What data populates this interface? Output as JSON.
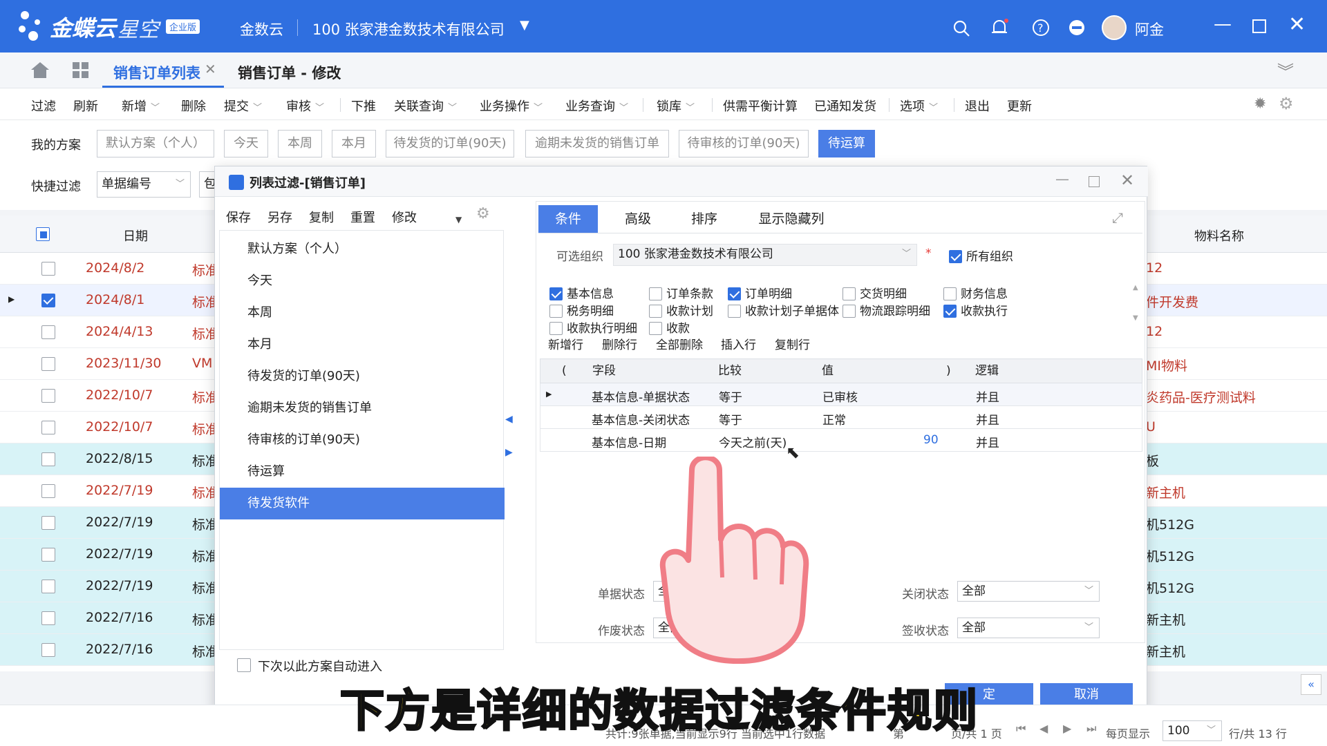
{
  "topbar": {
    "brand": "金蝶云",
    "brand2": "星空",
    "edition": "企业版",
    "tenant": "金数云",
    "org": "100  张家港金数技术有限公司",
    "user": "阿金"
  },
  "tabs": {
    "list_tab": "销售订单列表",
    "edit_tab": "销售订单 - 修改"
  },
  "toolbar": [
    "过滤",
    "刷新",
    "新增",
    "删除",
    "提交",
    "审核",
    "下推",
    "关联查询",
    "业务操作",
    "业务查询",
    "锁库",
    "供需平衡计算",
    "已通知发货",
    "选项",
    "退出",
    "更新"
  ],
  "scheme": {
    "label": "我的方案",
    "items": [
      "默认方案（个人）",
      "今天",
      "本周",
      "本月",
      "待发货的订单(90天)",
      "逾期未发货的销售订单",
      "待审核的订单(90天)",
      "待运算"
    ],
    "quick_label": "快捷过滤",
    "quick_field": "单据编号",
    "quick_extra": "包"
  },
  "list": {
    "col_date": "日期",
    "col_material": "物料名称",
    "rows": [
      {
        "date": "2024/8/2",
        "type": "标准",
        "mat": "12",
        "red": true
      },
      {
        "date": "2024/8/1",
        "type": "标准",
        "mat": "件开发费",
        "red": true,
        "checked": true
      },
      {
        "date": "2024/4/13",
        "type": "标准",
        "mat": "12",
        "red": true
      },
      {
        "date": "2023/11/30",
        "type": "VM",
        "mat": "MI物料",
        "red": true
      },
      {
        "date": "2022/10/7",
        "type": "标准",
        "mat": "炎药品-医疗测试料",
        "red": true
      },
      {
        "date": "2022/10/7",
        "type": "标准",
        "mat": "U",
        "red": true
      },
      {
        "date": "2022/8/15",
        "type": "标准",
        "mat": "板",
        "red": false
      },
      {
        "date": "2022/7/19",
        "type": "标准",
        "mat": "新主机",
        "red": true
      },
      {
        "date": "2022/7/19",
        "type": "标准",
        "mat": "机512G",
        "red": false
      },
      {
        "date": "2022/7/19",
        "type": "标准",
        "mat": "机512G",
        "red": false
      },
      {
        "date": "2022/7/19",
        "type": "标准",
        "mat": "机512G",
        "red": false
      },
      {
        "date": "2022/7/16",
        "type": "标准",
        "mat": "新主机",
        "red": false
      },
      {
        "date": "2022/7/16",
        "type": "标准",
        "mat": "新主机",
        "red": false
      }
    ]
  },
  "dialog": {
    "title": "列表过滤-[销售订单]",
    "actions": [
      "保存",
      "另存",
      "复制",
      "重置",
      "修改"
    ],
    "schemes": [
      "默认方案（个人）",
      "今天",
      "本周",
      "本月",
      "待发货的订单(90天)",
      "逾期未发货的销售订单",
      "待审核的订单(90天)",
      "待运算",
      "待发货软件"
    ],
    "auto_enter": "下次以此方案自动进入",
    "ctabs": [
      "条件",
      "高级",
      "排序",
      "显示隐藏列"
    ],
    "org_label": "可选组织",
    "org_value": "100 张家港金数技术有限公司",
    "all_org": "所有组织",
    "required": "*",
    "checks": [
      {
        "label": "基本信息",
        "on": true
      },
      {
        "label": "订单条款",
        "on": false
      },
      {
        "label": "订单明细",
        "on": true
      },
      {
        "label": "交货明细",
        "on": false
      },
      {
        "label": "财务信息",
        "on": false
      },
      {
        "label": "税务明细",
        "on": false
      },
      {
        "label": "收款计划",
        "on": false
      },
      {
        "label": "收款计划子单据体",
        "on": false
      },
      {
        "label": "物流跟踪明细",
        "on": false
      },
      {
        "label": "收款执行",
        "on": true
      },
      {
        "label": "收款执行明细",
        "on": false
      },
      {
        "label": "收款",
        "on": false
      }
    ],
    "row_actions": [
      "新增行",
      "删除行",
      "全部删除",
      "插入行",
      "复制行"
    ],
    "grid_head": [
      "(",
      "字段",
      "比较",
      "值",
      ")",
      "逻辑"
    ],
    "grid_rows": [
      {
        "field": "基本信息-单据状态",
        "cmp": "等于",
        "val": "已审核",
        "logic": "并且"
      },
      {
        "field": "基本信息-关闭状态",
        "cmp": "等于",
        "val": "正常",
        "logic": "并且"
      },
      {
        "field": "基本信息-日期",
        "cmp": "今天之前(天)",
        "val": "90",
        "logic": "并且"
      }
    ],
    "bill_status_label": "单据状态",
    "bill_status": "全",
    "close_status_label": "关闭状态",
    "close_status": "全部",
    "void_status_label": "作废状态",
    "void_status": "全部",
    "sign_status_label": "签收状态",
    "sign_status": "全部",
    "ok": "定",
    "cancel": "取消"
  },
  "footer": {
    "text": "共计:9张单据,当前显示9行  当前选中1行数据",
    "page_pre": "第",
    "page_post": "页/共 1 页",
    "per_page_label": "每页显示",
    "per_page": "100",
    "total": "行/共 13 行"
  },
  "caption": "下方是详细的数据过滤条件规则",
  "colors": {
    "accent": "#2f6fe0",
    "selected": "#4a7ee6",
    "red_text": "#c0392b",
    "cyan_row": "#d8f3f7"
  }
}
